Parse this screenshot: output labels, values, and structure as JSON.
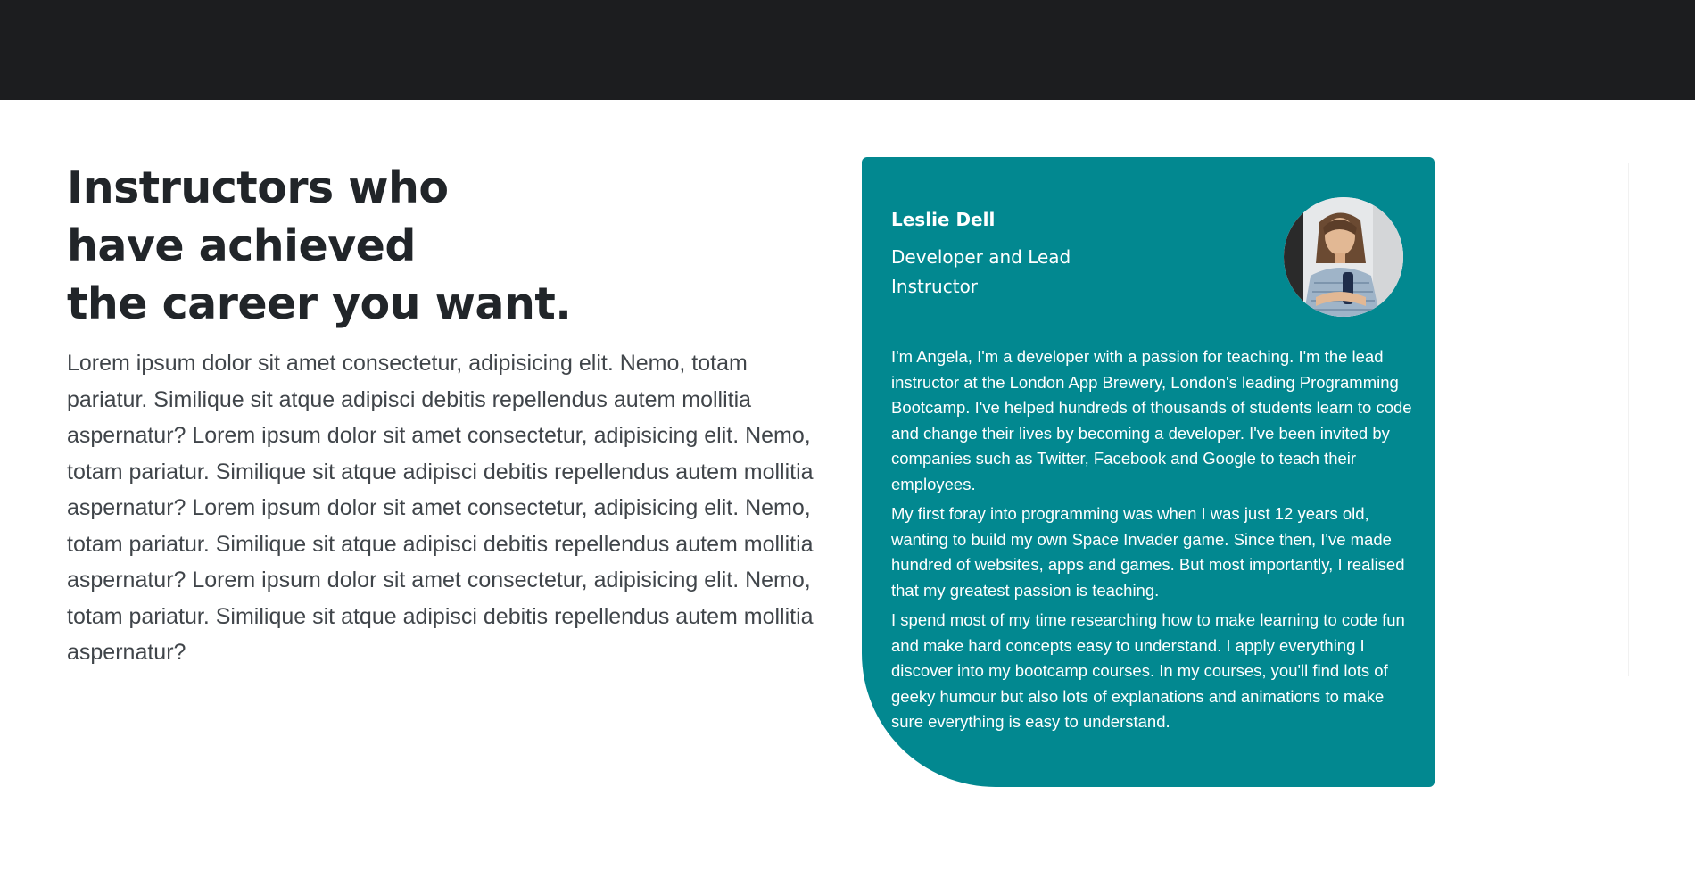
{
  "header": {},
  "intro": {
    "heading_line1": "Instructors who",
    "heading_line2": "have achieved",
    "heading_line3": "the career you want.",
    "body": "Lorem ipsum dolor sit amet consectetur, adipisicing elit. Nemo, totam pariatur. Similique sit atque adipisci debitis repellendus autem mollitia aspernatur? Lorem ipsum dolor sit amet consectetur, adipisicing elit. Nemo, totam pariatur. Similique sit atque adipisci debitis repellendus autem mollitia aspernatur? Lorem ipsum dolor sit amet consectetur, adipisicing elit. Nemo, totam pariatur. Similique sit atque adipisci debitis repellendus autem mollitia aspernatur? Lorem ipsum dolor sit amet consectetur, adipisicing elit. Nemo, totam pariatur. Similique sit atque adipisci debitis repellendus autem mollitia aspernatur?"
  },
  "instructor": {
    "name": "Leslie Dell",
    "role": "Developer and Lead Instructor",
    "avatar_icon": "instructor-photo",
    "bio": [
      "I'm Angela, I'm a developer with a passion for teaching. I'm the lead instructor at the London App Brewery, London's leading Programming Bootcamp. I've helped hundreds of thousands of students learn to code and change their lives by becoming a developer. I've been invited by companies such as Twitter, Facebook and Google to teach their employees.",
      "My first foray into programming was when I was just 12 years old, wanting to build my own Space Invader game. Since then, I've made hundred of websites, apps and games. But most importantly, I realised that my greatest passion is teaching.",
      "I spend most of my time researching how to make learning to code fun and make hard concepts easy to understand. I apply everything I discover into my bootcamp courses. In my courses, you'll find lots of geeky humour but also lots of explanations and animations to make sure everything is easy to understand."
    ]
  },
  "colors": {
    "topbar": "#1c1d1f",
    "card": "#028890",
    "heading": "#212529",
    "body_text": "#40454a"
  }
}
